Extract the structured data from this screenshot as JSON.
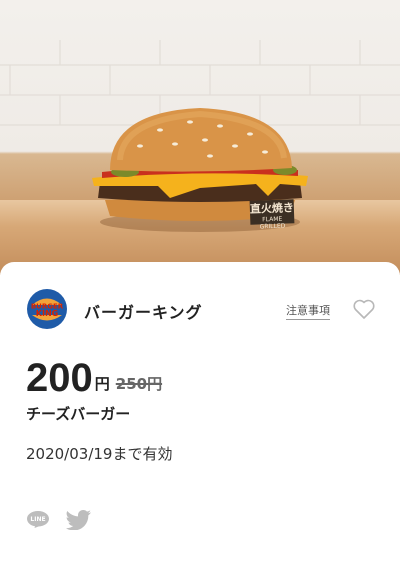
{
  "hero": {
    "image": "cheeseburger-photo",
    "stamp_text": "直火焼き",
    "stamp_sub": "FLAME GRILLED"
  },
  "brand": {
    "logo_top": "BURGER",
    "logo_bottom": "KING",
    "name": "バーガーキング",
    "colors": {
      "red": "#d62300",
      "blue": "#1f5ba8",
      "bun": "#f2a33a"
    }
  },
  "notice_label": "注意事項",
  "favorite_icon": "heart-outline-icon",
  "coupon": {
    "price": "200",
    "yen": "円",
    "original_price": "250円",
    "item_name": "チーズバーガー",
    "validity": "2020/03/19まで有効"
  },
  "share": {
    "line_label": "LINE",
    "twitter_icon": "twitter-bird-icon"
  }
}
